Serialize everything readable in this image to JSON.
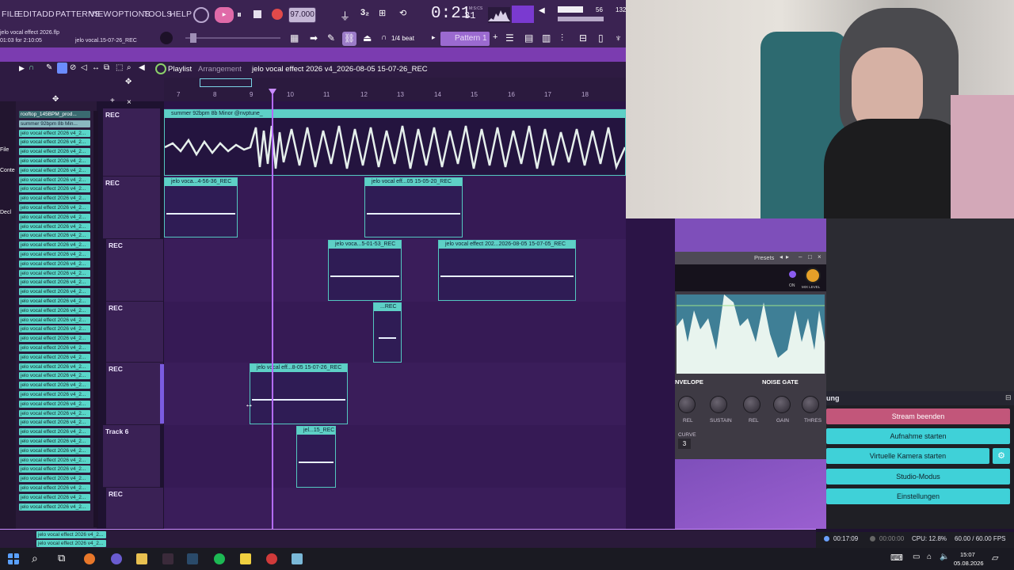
{
  "menu": {
    "file": "FILE",
    "edit": "EDIT",
    "add": "ADD",
    "patterns": "PATTERNS",
    "view": "VIEW",
    "options": "OPTIONS",
    "tools": "TOOLS",
    "help": "HELP"
  },
  "transport": {
    "tempo": "97.000",
    "time": "0:21",
    "time_sub": "31",
    "time_unit": "M:S:CS",
    "cpu_num": "56",
    "ram_num": "132",
    "pattern": "Pattern 1",
    "snap": "1/4 beat"
  },
  "project": {
    "file": "jelo vocal effect 2026.flp",
    "hint": "01:03 for 2:10:05",
    "clip_hint": "jelo vocal.15-07-26_REC"
  },
  "playlist": {
    "title": "Playlist",
    "subtitle": "Arrangement",
    "name": "jelo vocal effect 2026 v4_2026-08-05 15-07-26_REC"
  },
  "ruler": [
    "7",
    "8",
    "9",
    "10",
    "11",
    "12",
    "13",
    "14",
    "15",
    "16",
    "17",
    "18"
  ],
  "channels": [
    "rooftop_145BPM_prod...",
    "summer 92bpm 8b Min...",
    "jelo vocal effect 2026 v4_2...",
    "jelo vocal effect 2026 v4_2...",
    "jelo vocal effect 2026 v4_2...",
    "jelo vocal effect 2026 v4_2...",
    "jelo vocal effect 2026 v4_2...",
    "jelo vocal effect 2026 v4_2...",
    "jelo vocal effect 2026 v4_2...",
    "jelo vocal effect 2026 v4_2...",
    "jelo vocal effect 2026 v4_2...",
    "jelo vocal effect 2026 v4_2...",
    "jelo vocal effect 2026 v4_2...",
    "jelo vocal effect 2026 v4_2...",
    "jelo vocal effect 2026 v4_2...",
    "jelo vocal effect 2026 v4_2...",
    "jelo vocal effect 2026 v4_2...",
    "jelo vocal effect 2026 v4_2...",
    "jelo vocal effect 2026 v4_2...",
    "jelo vocal effect 2026 v4_2...",
    "jelo vocal effect 2026 v4_2...",
    "jelo vocal effect 2026 v4_2...",
    "jelo vocal effect 2026 v4_2...",
    "jelo vocal effect 2026 v4_2...",
    "jelo vocal effect 2026 v4_2...",
    "jelo vocal effect 2026 v4_2...",
    "jelo vocal effect 2026 v4_2...",
    "jelo vocal effect 2026 v4_2...",
    "jelo vocal effect 2026 v4_2...",
    "jelo vocal effect 2026 v4_2...",
    "jelo vocal effect 2026 v4_2...",
    "jelo vocal effect 2026 v4_2...",
    "jelo vocal effect 2026 v4_2...",
    "jelo vocal effect 2026 v4_2...",
    "jelo vocal effect 2026 v4_2...",
    "jelo vocal effect 2026 v4_2...",
    "jelo vocal effect 2026 v4_2...",
    "jelo vocal effect 2026 v4_2...",
    "jelo vocal effect 2026 v4_2...",
    "jelo vocal effect 2026 v4_2...",
    "jelo vocal effect 2026 v4_2...",
    "jelo vocal effect 2026 v4_2...",
    "jelo vocal effect 2026 v4_2..."
  ],
  "left_labels": {
    "file": "File",
    "conte": "Conte",
    "decl": "Decl"
  },
  "tracks": [
    "REC",
    "REC",
    "REC",
    "REC",
    "REC",
    "Track 6",
    "REC"
  ],
  "clips": {
    "summer": "summer 92bpm 8b Minor @nvptune_",
    "c1": "jelo voca...4-56-36_REC",
    "c2": "jelo vocal eff...05 15-05-20_REC",
    "c3": "jelo voca...5-01-53_REC",
    "c4": "jelo vocal effect 202...2026-08-05 15-07-05_REC",
    "c5": "...REC",
    "c6": "jelo vocal eff...8-05 15-07-26_REC",
    "c7": "jel...15_REC"
  },
  "bottom_chans": [
    "jelo vocal effect 2026 v4_2...",
    "jelo vocal effect 2026 v4_2..."
  ],
  "plugin": {
    "presets": "Presets",
    "on": "ON",
    "mix": "MIX LEVEL",
    "envelope": "NVELOPE",
    "noise_gate": "NOISE GATE",
    "knobs": [
      "REL",
      "SUSTAIN",
      "REL",
      "GAIN",
      "THRES"
    ],
    "curve": "CURVE",
    "curve_val": "3"
  },
  "obs": {
    "section": "ung",
    "buttons": [
      "Stream beenden",
      "Aufnahme starten",
      "Virtuelle Kamera starten",
      "Studio-Modus",
      "Einstellungen"
    ],
    "live": "00:17:09",
    "rec": "00:00:00",
    "cpu": "CPU: 12.8%",
    "fps": "60.00 / 60.00 FPS"
  },
  "clock": {
    "time": "15:07",
    "date": "05.08.2026"
  },
  "colors": {
    "accent": "#5ed0c6",
    "bg": "#3a1d5a",
    "stream_btn": "#c2567a",
    "obs_btn": "#3fd1d8"
  }
}
